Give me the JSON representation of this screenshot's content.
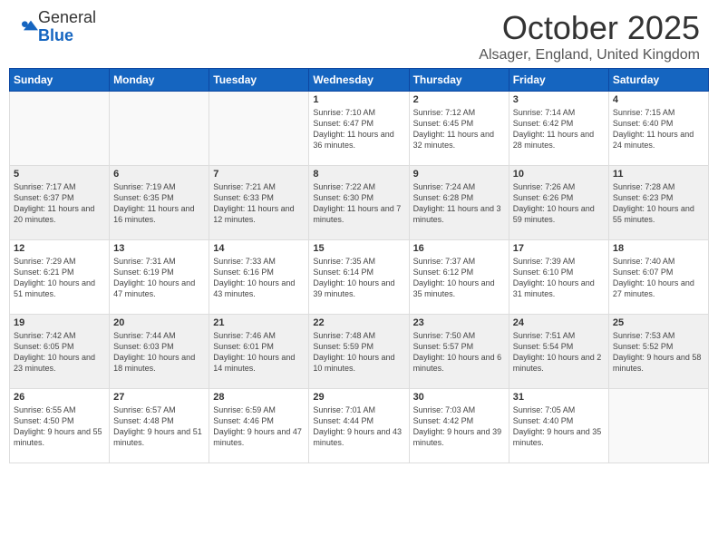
{
  "header": {
    "logo": {
      "general": "General",
      "blue": "Blue"
    },
    "title": "October 2025",
    "location": "Alsager, England, United Kingdom"
  },
  "weekdays": [
    "Sunday",
    "Monday",
    "Tuesday",
    "Wednesday",
    "Thursday",
    "Friday",
    "Saturday"
  ],
  "weeks": [
    {
      "days": [
        {
          "num": "",
          "empty": true
        },
        {
          "num": "",
          "empty": true
        },
        {
          "num": "",
          "empty": true
        },
        {
          "num": "1",
          "rise": "7:10 AM",
          "set": "6:47 PM",
          "daylight": "11 hours and 36 minutes."
        },
        {
          "num": "2",
          "rise": "7:12 AM",
          "set": "6:45 PM",
          "daylight": "11 hours and 32 minutes."
        },
        {
          "num": "3",
          "rise": "7:14 AM",
          "set": "6:42 PM",
          "daylight": "11 hours and 28 minutes."
        },
        {
          "num": "4",
          "rise": "7:15 AM",
          "set": "6:40 PM",
          "daylight": "11 hours and 24 minutes."
        }
      ]
    },
    {
      "days": [
        {
          "num": "5",
          "rise": "7:17 AM",
          "set": "6:37 PM",
          "daylight": "11 hours and 20 minutes."
        },
        {
          "num": "6",
          "rise": "7:19 AM",
          "set": "6:35 PM",
          "daylight": "11 hours and 16 minutes."
        },
        {
          "num": "7",
          "rise": "7:21 AM",
          "set": "6:33 PM",
          "daylight": "11 hours and 12 minutes."
        },
        {
          "num": "8",
          "rise": "7:22 AM",
          "set": "6:30 PM",
          "daylight": "11 hours and 7 minutes."
        },
        {
          "num": "9",
          "rise": "7:24 AM",
          "set": "6:28 PM",
          "daylight": "11 hours and 3 minutes."
        },
        {
          "num": "10",
          "rise": "7:26 AM",
          "set": "6:26 PM",
          "daylight": "10 hours and 59 minutes."
        },
        {
          "num": "11",
          "rise": "7:28 AM",
          "set": "6:23 PM",
          "daylight": "10 hours and 55 minutes."
        }
      ]
    },
    {
      "days": [
        {
          "num": "12",
          "rise": "7:29 AM",
          "set": "6:21 PM",
          "daylight": "10 hours and 51 minutes."
        },
        {
          "num": "13",
          "rise": "7:31 AM",
          "set": "6:19 PM",
          "daylight": "10 hours and 47 minutes."
        },
        {
          "num": "14",
          "rise": "7:33 AM",
          "set": "6:16 PM",
          "daylight": "10 hours and 43 minutes."
        },
        {
          "num": "15",
          "rise": "7:35 AM",
          "set": "6:14 PM",
          "daylight": "10 hours and 39 minutes."
        },
        {
          "num": "16",
          "rise": "7:37 AM",
          "set": "6:12 PM",
          "daylight": "10 hours and 35 minutes."
        },
        {
          "num": "17",
          "rise": "7:39 AM",
          "set": "6:10 PM",
          "daylight": "10 hours and 31 minutes."
        },
        {
          "num": "18",
          "rise": "7:40 AM",
          "set": "6:07 PM",
          "daylight": "10 hours and 27 minutes."
        }
      ]
    },
    {
      "days": [
        {
          "num": "19",
          "rise": "7:42 AM",
          "set": "6:05 PM",
          "daylight": "10 hours and 23 minutes."
        },
        {
          "num": "20",
          "rise": "7:44 AM",
          "set": "6:03 PM",
          "daylight": "10 hours and 18 minutes."
        },
        {
          "num": "21",
          "rise": "7:46 AM",
          "set": "6:01 PM",
          "daylight": "10 hours and 14 minutes."
        },
        {
          "num": "22",
          "rise": "7:48 AM",
          "set": "5:59 PM",
          "daylight": "10 hours and 10 minutes."
        },
        {
          "num": "23",
          "rise": "7:50 AM",
          "set": "5:57 PM",
          "daylight": "10 hours and 6 minutes."
        },
        {
          "num": "24",
          "rise": "7:51 AM",
          "set": "5:54 PM",
          "daylight": "10 hours and 2 minutes."
        },
        {
          "num": "25",
          "rise": "7:53 AM",
          "set": "5:52 PM",
          "daylight": "9 hours and 58 minutes."
        }
      ]
    },
    {
      "days": [
        {
          "num": "26",
          "rise": "6:55 AM",
          "set": "4:50 PM",
          "daylight": "9 hours and 55 minutes."
        },
        {
          "num": "27",
          "rise": "6:57 AM",
          "set": "4:48 PM",
          "daylight": "9 hours and 51 minutes."
        },
        {
          "num": "28",
          "rise": "6:59 AM",
          "set": "4:46 PM",
          "daylight": "9 hours and 47 minutes."
        },
        {
          "num": "29",
          "rise": "7:01 AM",
          "set": "4:44 PM",
          "daylight": "9 hours and 43 minutes."
        },
        {
          "num": "30",
          "rise": "7:03 AM",
          "set": "4:42 PM",
          "daylight": "9 hours and 39 minutes."
        },
        {
          "num": "31",
          "rise": "7:05 AM",
          "set": "4:40 PM",
          "daylight": "9 hours and 35 minutes."
        },
        {
          "num": "",
          "empty": true
        }
      ]
    }
  ]
}
